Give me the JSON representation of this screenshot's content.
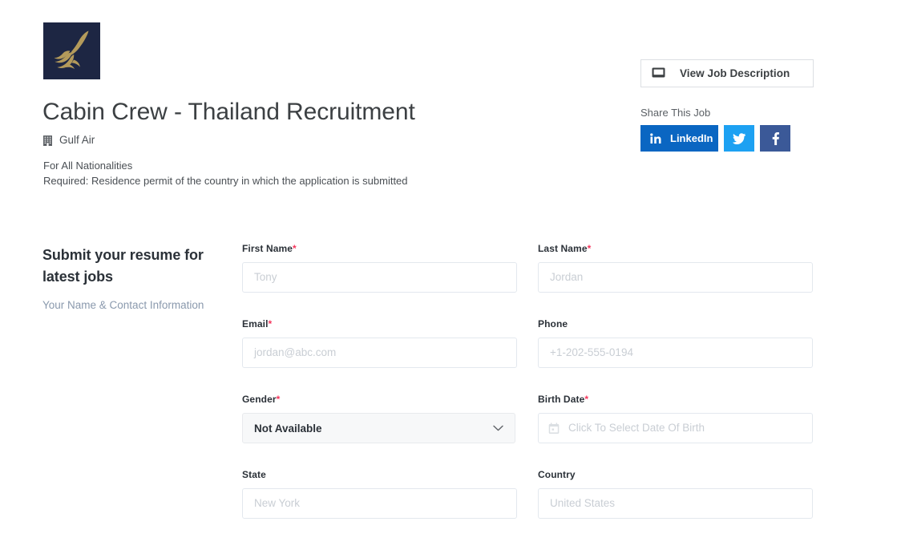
{
  "header": {
    "logo_icon": "gulf-air-falcon-logo",
    "logo_bg": "#1d2643",
    "logo_fg": "#b39a5b",
    "job_title": "Cabin Crew - Thailand Recruitment",
    "company_icon": "building-icon",
    "company_name": "Gulf Air",
    "meta_lines": [
      "For All Nationalities",
      "Required: Residence permit of the country in which the application is submitted"
    ]
  },
  "right_rail": {
    "view_jd": {
      "icon": "monitor-icon",
      "label": "View Job Description"
    },
    "share_label": "Share This Job",
    "share_buttons": [
      {
        "network": "linkedin",
        "icon": "linkedin-icon",
        "label": "LinkedIn",
        "color": "#0a66c2"
      },
      {
        "network": "twitter",
        "icon": "twitter-bird-icon",
        "label": "",
        "color": "#1da1f2"
      },
      {
        "network": "facebook",
        "icon": "facebook-f-icon",
        "label": "",
        "color": "#3b5998"
      }
    ]
  },
  "form": {
    "intro_title": "Submit your resume for latest jobs",
    "intro_subtitle": "Your Name & Contact Information",
    "required_marker": "*",
    "rows": [
      [
        {
          "name": "first-name",
          "label": "First Name",
          "required": true,
          "type": "text",
          "value": "",
          "placeholder": "Tony"
        },
        {
          "name": "last-name",
          "label": "Last Name",
          "required": true,
          "type": "text",
          "value": "",
          "placeholder": "Jordan"
        }
      ],
      [
        {
          "name": "email",
          "label": "Email",
          "required": true,
          "type": "email",
          "value": "",
          "placeholder": "jordan@abc.com"
        },
        {
          "name": "phone",
          "label": "Phone",
          "required": false,
          "type": "tel",
          "value": "",
          "placeholder": "+1-202-555-0194"
        }
      ],
      [
        {
          "name": "gender",
          "label": "Gender",
          "required": true,
          "type": "select",
          "value": "Not Available",
          "placeholder": "",
          "icon": "chevron-down-icon"
        },
        {
          "name": "birth-date",
          "label": "Birth Date",
          "required": true,
          "type": "date",
          "value": "",
          "placeholder": "Click To Select Date Of Birth",
          "icon": "calendar-icon"
        }
      ],
      [
        {
          "name": "state",
          "label": "State",
          "required": false,
          "type": "text",
          "value": "",
          "placeholder": "New York"
        },
        {
          "name": "country",
          "label": "Country",
          "required": false,
          "type": "text",
          "value": "",
          "placeholder": "United States"
        }
      ]
    ]
  }
}
